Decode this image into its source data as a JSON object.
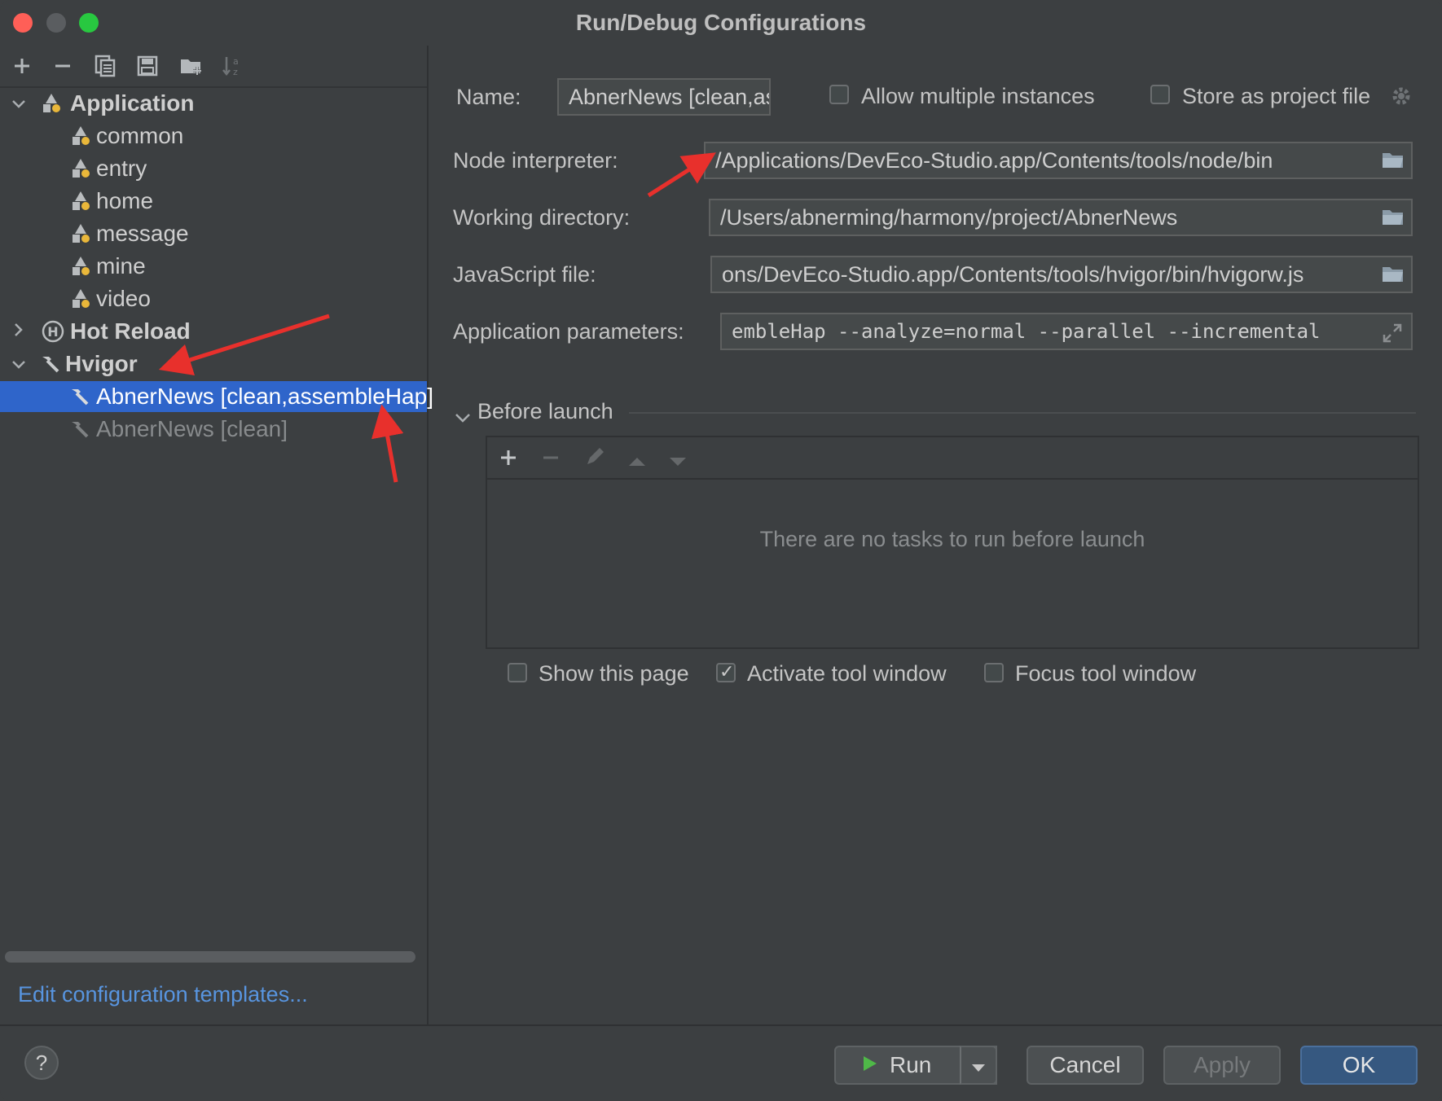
{
  "window": {
    "title": "Run/Debug Configurations"
  },
  "left_toolbar": {
    "icons": [
      "add-icon",
      "remove-icon",
      "copy-icon",
      "save-icon",
      "folder-add-icon",
      "sort-icon"
    ]
  },
  "tree": {
    "application": {
      "label": "Application",
      "children": [
        "common",
        "entry",
        "home",
        "message",
        "mine",
        "video"
      ]
    },
    "hot_reload": {
      "label": "Hot Reload"
    },
    "hvigor": {
      "label": "Hvigor",
      "children": [
        "AbnerNews [clean,assembleHap]",
        "AbnerNews [clean]"
      ]
    }
  },
  "edit_templates_link": "Edit configuration templates...",
  "form": {
    "name_label": "Name:",
    "name_value": "AbnerNews [clean,assembleHap]",
    "allow_multiple_label": "Allow multiple instances",
    "allow_multiple_checked": false,
    "store_project_label": "Store as project file",
    "store_project_checked": false,
    "node_label": "Node interpreter:",
    "node_value": "/Applications/DevEco-Studio.app/Contents/tools/node/bin",
    "workdir_label": "Working directory:",
    "workdir_value": "/Users/abnerming/harmony/project/AbnerNews",
    "jsfile_label": "JavaScript file:",
    "jsfile_value": "ons/DevEco-Studio.app/Contents/tools/hvigor/bin/hvigorw.js",
    "params_label": "Application parameters:",
    "params_value": "embleHap --analyze=normal --parallel --incremental"
  },
  "before_launch": {
    "title": "Before launch",
    "empty_text": "There are no tasks to run before launch",
    "toolbar_icons": [
      "add-icon",
      "remove-icon",
      "edit-icon",
      "move-up-icon",
      "move-down-icon"
    ]
  },
  "options": {
    "show_page_label": "Show this page",
    "show_page_checked": false,
    "activate_tool_label": "Activate tool window",
    "activate_tool_checked": true,
    "focus_tool_label": "Focus tool window",
    "focus_tool_checked": false
  },
  "buttons": {
    "help": "?",
    "run": "Run",
    "cancel": "Cancel",
    "apply": "Apply",
    "ok": "OK"
  },
  "colors": {
    "background": "#3c3f41",
    "selection": "#2f65ca",
    "link": "#5895e0",
    "annotation_arrow": "#e8302c",
    "ok_button": "#365880"
  }
}
